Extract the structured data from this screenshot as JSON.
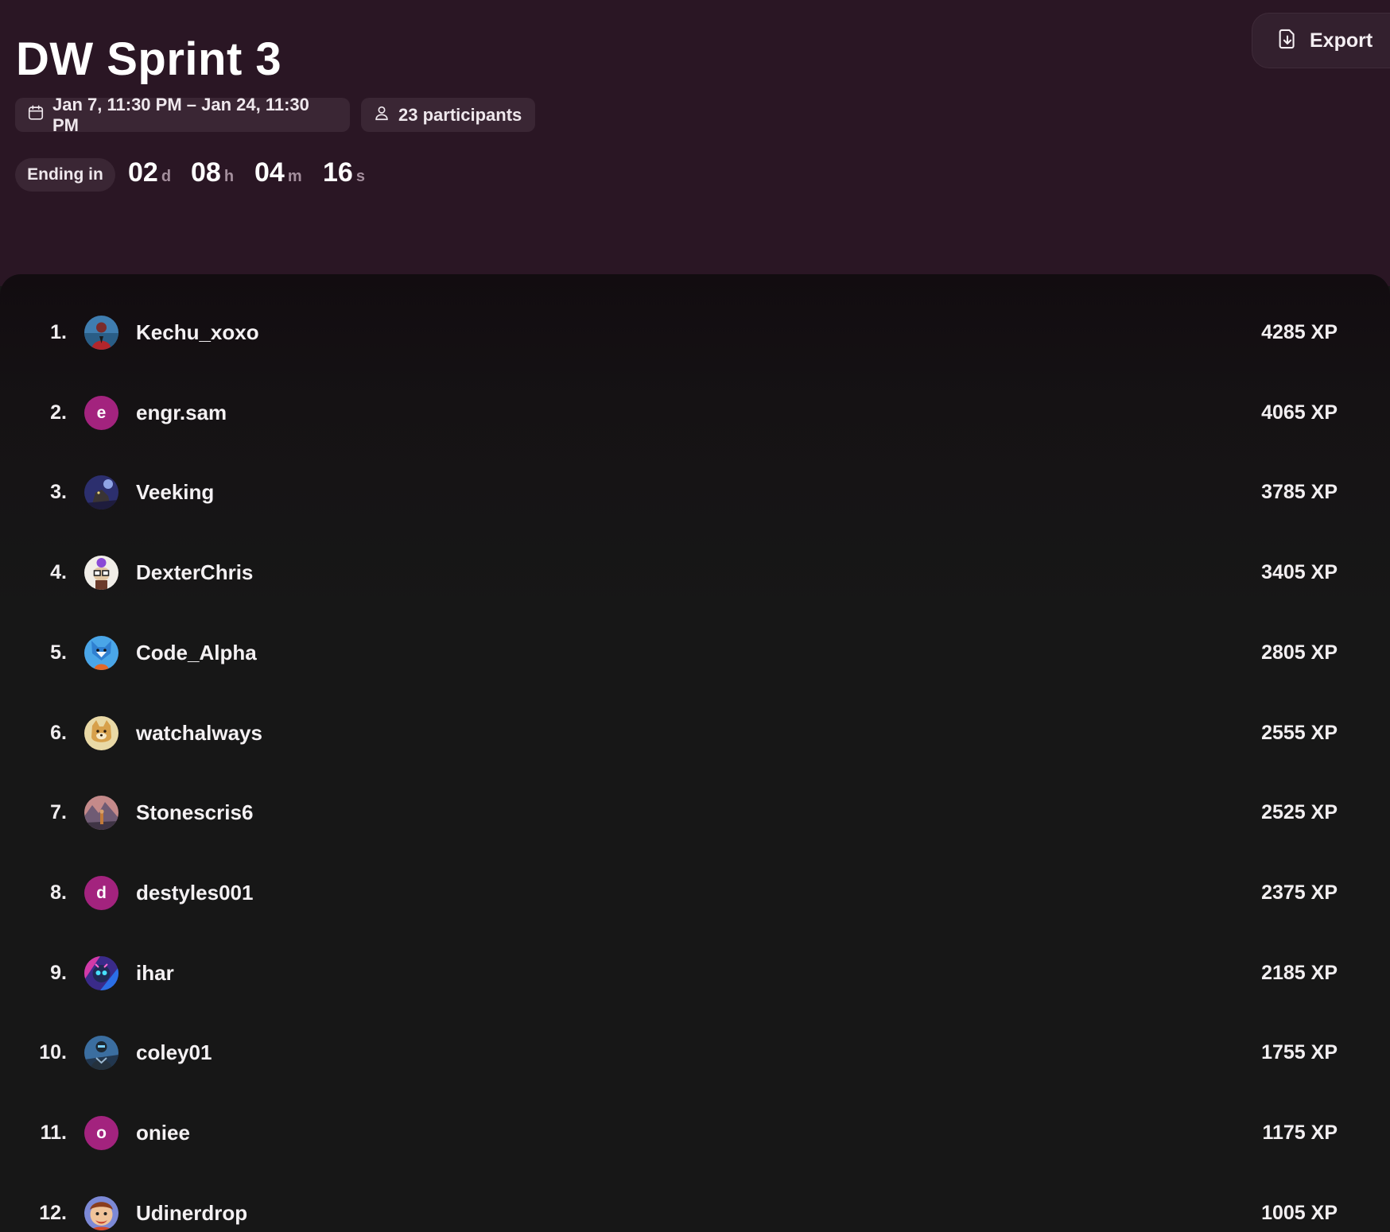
{
  "header": {
    "title": "DW Sprint 3",
    "export_label": "Export",
    "date_range": "Jan 7, 11:30 PM – Jan 24, 11:30 PM",
    "participants": "23 participants",
    "ending_label": "Ending in",
    "countdown": {
      "days": "02",
      "days_unit": "d",
      "hours": "08",
      "hours_unit": "h",
      "minutes": "04",
      "minutes_unit": "m",
      "seconds": "16",
      "seconds_unit": "s"
    }
  },
  "colors": {
    "header_bg": "#2a1624",
    "chip_bg": "#3a2634",
    "letter_avatar": "#a3237e"
  },
  "leaderboard": [
    {
      "rank": "1.",
      "name": "Kechu_xoxo",
      "xp": "4285 XP",
      "avatar": {
        "type": "image",
        "icon": "person-red-suit"
      }
    },
    {
      "rank": "2.",
      "name": "engr.sam",
      "xp": "4065 XP",
      "avatar": {
        "type": "letter",
        "letter": "e"
      }
    },
    {
      "rank": "3.",
      "name": "Veeking",
      "xp": "3785 XP",
      "avatar": {
        "type": "image",
        "icon": "night-creature"
      }
    },
    {
      "rank": "4.",
      "name": "DexterChris",
      "xp": "3405 XP",
      "avatar": {
        "type": "image",
        "icon": "glasses-character"
      }
    },
    {
      "rank": "5.",
      "name": "Code_Alpha",
      "xp": "2805 XP",
      "avatar": {
        "type": "image",
        "icon": "blue-fox"
      }
    },
    {
      "rank": "6.",
      "name": "watchalways",
      "xp": "2555 XP",
      "avatar": {
        "type": "image",
        "icon": "shiba-dog"
      }
    },
    {
      "rank": "7.",
      "name": "Stonescris6",
      "xp": "2525 XP",
      "avatar": {
        "type": "image",
        "icon": "landscape-figure"
      }
    },
    {
      "rank": "8.",
      "name": "destyles001",
      "xp": "2375 XP",
      "avatar": {
        "type": "letter",
        "letter": "d"
      }
    },
    {
      "rank": "9.",
      "name": "ihar",
      "xp": "2185 XP",
      "avatar": {
        "type": "image",
        "icon": "neon-robot"
      }
    },
    {
      "rank": "10.",
      "name": "coley01",
      "xp": "1755 XP",
      "avatar": {
        "type": "image",
        "icon": "armored-figure"
      }
    },
    {
      "rank": "11.",
      "name": "oniee",
      "xp": "1175 XP",
      "avatar": {
        "type": "letter",
        "letter": "o"
      }
    },
    {
      "rank": "12.",
      "name": "Udinerdrop",
      "xp": "1005 XP",
      "avatar": {
        "type": "image",
        "icon": "cartoon-face"
      }
    }
  ]
}
